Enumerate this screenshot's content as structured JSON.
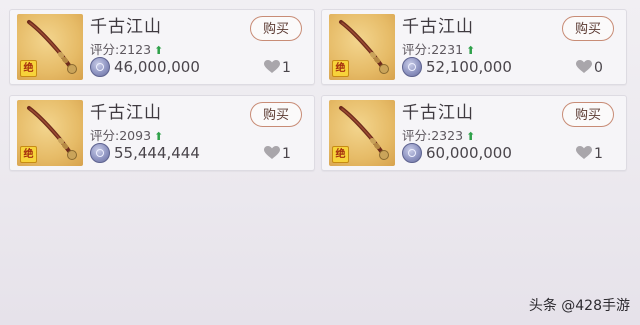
{
  "listings": [
    {
      "name": "千古江山",
      "score_label": "评分:",
      "score": "2123",
      "price": "46,000,000",
      "likes": "1",
      "buy_label": "购买",
      "badge": "绝",
      "icon": "staff-weapon-icon"
    },
    {
      "name": "千古江山",
      "score_label": "评分:",
      "score": "2231",
      "price": "52,100,000",
      "likes": "0",
      "buy_label": "购买",
      "badge": "绝",
      "icon": "staff-weapon-icon"
    },
    {
      "name": "千古江山",
      "score_label": "评分:",
      "score": "2093",
      "price": "55,444,444",
      "likes": "1",
      "buy_label": "购买",
      "badge": "绝",
      "icon": "staff-weapon-icon"
    },
    {
      "name": "千古江山",
      "score_label": "评分:",
      "score": "2323",
      "price": "60,000,000",
      "likes": "1",
      "buy_label": "购买",
      "badge": "绝",
      "icon": "staff-weapon-icon"
    }
  ],
  "watermark": "头条 @428手游",
  "colors": {
    "up_arrow": "#2fa14a",
    "buy_border": "#c88c76",
    "heart": "#a9a6ab"
  }
}
